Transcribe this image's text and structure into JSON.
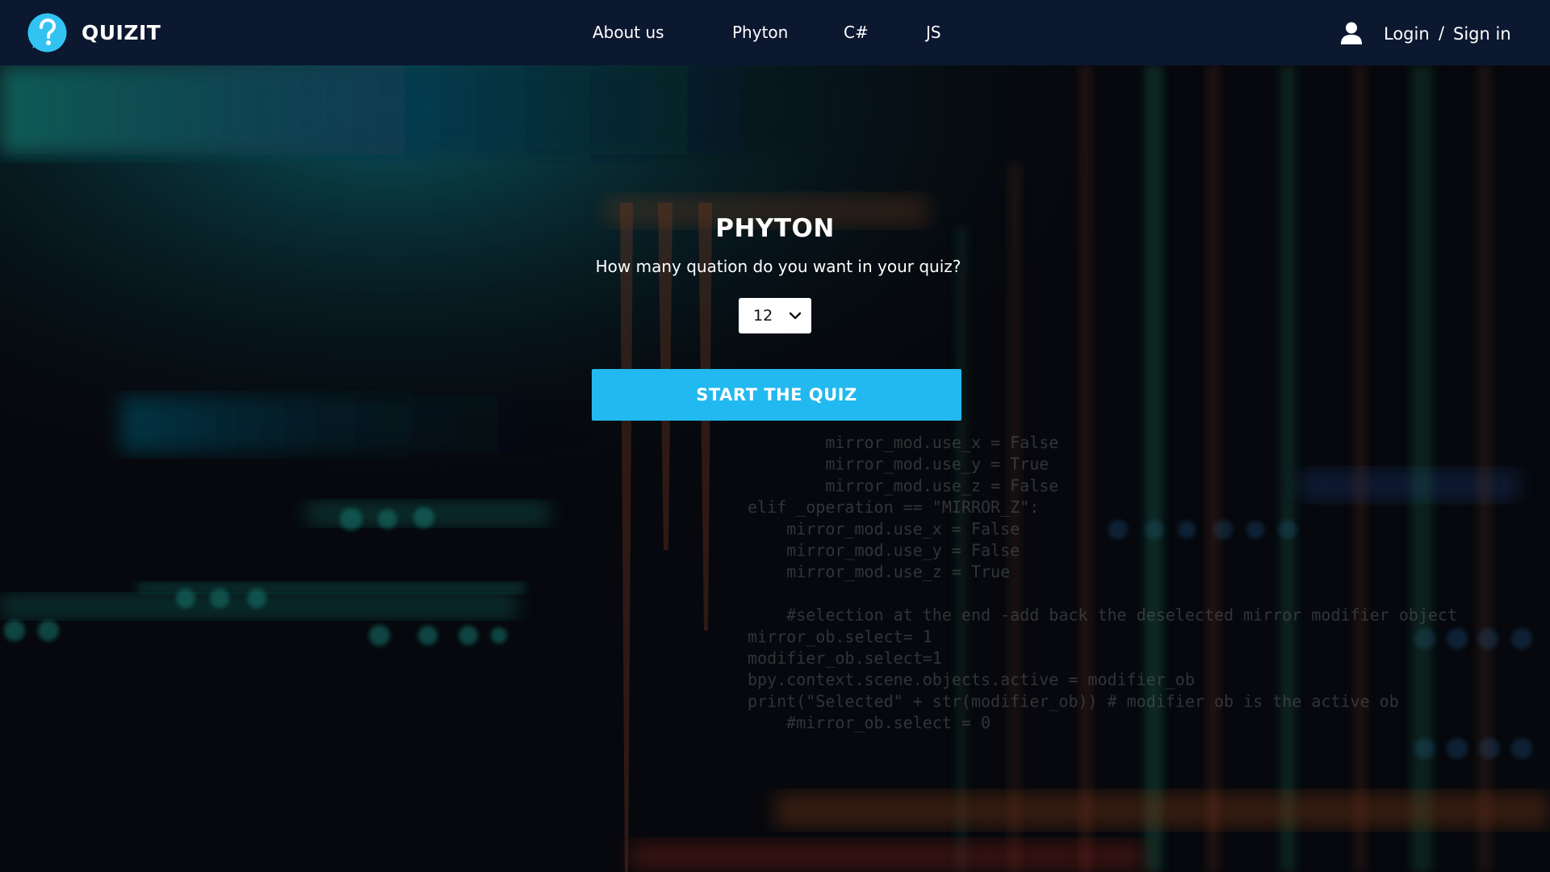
{
  "header": {
    "brand": {
      "name": "QUIZIT",
      "logo_icon": "question-mark-bubble-icon",
      "logo_color": "#33c3f2"
    },
    "nav": [
      {
        "label": "About us"
      },
      {
        "label": "Phyton"
      },
      {
        "label": "C#"
      },
      {
        "label": "JS"
      }
    ],
    "auth": {
      "user_icon": "user-icon",
      "login_label": "Login",
      "separator": "/",
      "signin_label": "Sign in"
    },
    "background_color": "#0c1730"
  },
  "main": {
    "title": "PHYTON",
    "question": "How many quation do you want in your quiz?",
    "count_select": {
      "value": "12",
      "icon": "chevron-down-icon"
    },
    "start_button": {
      "label": "START THE QUIZ",
      "color": "#22b8f0"
    }
  },
  "background_code": [
    "        mirror_mod.use_x = False",
    "        mirror_mod.use_y = True",
    "        mirror_mod.use_z = False",
    "elif _operation == \"MIRROR_Z\":",
    "    mirror_mod.use_x = False",
    "    mirror_mod.use_y = False",
    "    mirror_mod.use_z = True",
    "",
    "    #selection at the end -add back the deselected mirror modifier object",
    "mirror_ob.select= 1",
    "modifier_ob.select=1",
    "bpy.context.scene.objects.active = modifier_ob",
    "print(\"Selected\" + str(modifier_ob)) # modifier ob is the active ob",
    "    #mirror_ob.select = 0"
  ]
}
